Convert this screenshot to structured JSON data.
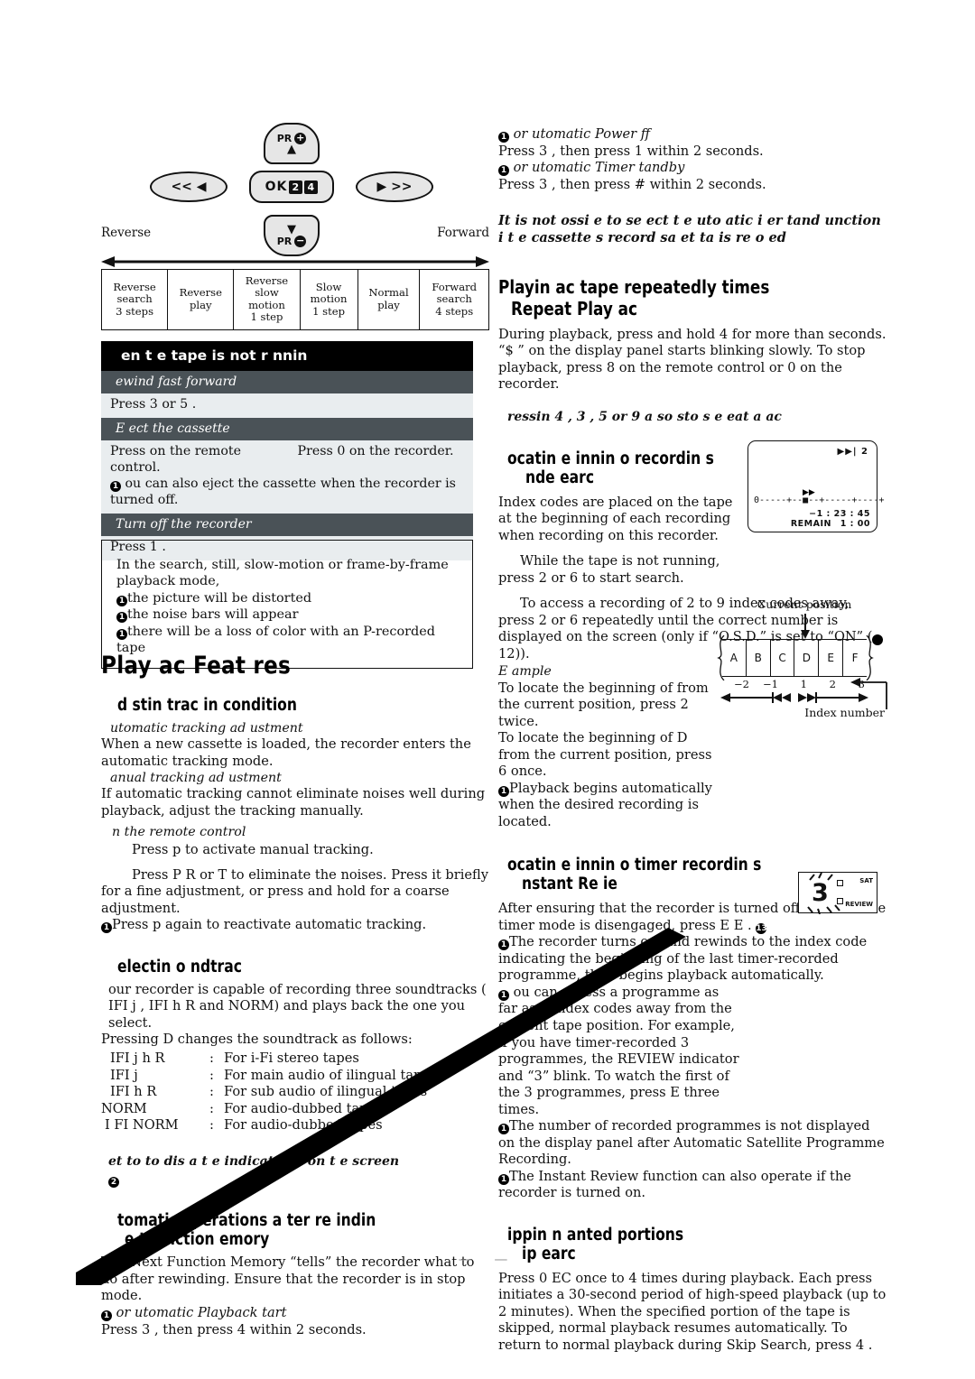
{
  "remote": {
    "key_up_label": "PR",
    "key_up_sign": "+",
    "key_up_arrow": "▲",
    "key_down_label": "PR",
    "key_down_sign": "−",
    "key_down_arrow": "▼",
    "key_ok_label": "OK",
    "key_ok_badge_a": "2",
    "key_ok_badge_b": "4",
    "key_left_label": "<< ◀",
    "key_right_label": "▶ >>",
    "label_reverse": "Reverse",
    "label_forward": "Forward"
  },
  "mode_table": {
    "cells": [
      "Reverse\nsearch\n3 steps",
      "Reverse\nplay",
      "Reverse\nslow\nmotion\n1 step",
      "Slow\nmotion\n1 step",
      "Normal\nplay",
      "Forward\nsearch\n4 steps"
    ]
  },
  "dark_table": {
    "title": "en t  e tape is not r  nnin",
    "rows": [
      {
        "kind": "sub",
        "left": "ewind fast forward",
        "right": ""
      },
      {
        "kind": "body",
        "left": "Press 3    or 5   .",
        "right": "",
        "single": true
      },
      {
        "kind": "sub",
        "left": "E ect the cassette",
        "right": ""
      },
      {
        "kind": "body",
        "left": "Press        on the remote control.",
        "right": "Press 0        on the recorder.",
        "single": false
      },
      {
        "kind": "note",
        "text": " ou can also eject the cassette when the recorder is turned off."
      },
      {
        "kind": "sub",
        "left": "Turn off the recorder",
        "right": ""
      },
      {
        "kind": "body",
        "left": "Press 1  .",
        "right": "",
        "single": true
      }
    ]
  },
  "note_box": {
    "intro": "In the search, still, slow-motion or frame-by-frame playback mode,",
    "items": [
      "the picture will be distorted",
      "the noise bars will appear",
      "there will be a loss of color with an   P-recorded tape"
    ]
  },
  "left_column": {
    "main_heading": "Play ac  Feat res",
    "sections": [
      {
        "id": "tracking",
        "heading": "d stin  trac in  condition",
        "blocks": [
          {
            "type": "subitalic",
            "text": " utomatic tracking ad ustment"
          },
          {
            "type": "para",
            "text": "When a new cassette is loaded, the recorder enters the automatic tracking mode."
          },
          {
            "type": "subitalic",
            "text": " anual tracking ad ustment"
          },
          {
            "type": "para",
            "text": "If automatic tracking cannot eliminate noises well during playback, adjust the tracking manually."
          },
          {
            "type": "subitalic-ind",
            "text": " n the remote control"
          },
          {
            "type": "para-ind",
            "text": "Press  p      to activate manual tracking."
          },
          {
            "type": "para-ind",
            "text": "Press  P  R  or T  to eliminate the noises. Press it briefly for a fine adjustment, or press and hold for a coarse adjustment."
          },
          {
            "type": "bullet",
            "text": "Press  p      again to reactivate automatic tracking."
          }
        ]
      },
      {
        "id": "soundtrack",
        "heading": "electin   o ndtrac",
        "blocks": [
          {
            "type": "para-ind",
            "text": " our recorder is capable of recording three soundtracks (   IFI    j ,  IFI h  R and NORM) and plays back the one you select."
          },
          {
            "type": "para",
            "text": "Pressing       D     changes the soundtrack as follows:"
          }
        ],
        "list": [
          {
            "left": "IFI    j h    R",
            "right": "For    i-Fi stereo tapes"
          },
          {
            "left": "IFI    j",
            "right": "For main audio of   ilingual tapes"
          },
          {
            "left": "IFI h  R",
            "right": "For sub audio of   ilingual tapes"
          },
          {
            "left": "NORM",
            "right": "For audio-dubbed tapes"
          },
          {
            "left": " I FI NORM",
            "right": "For audio-dubbed tapes"
          }
        ],
        "footnote": " et           to        to dis  a  t e indications on t e screen"
      },
      {
        "id": "next-function-memory",
        "heading_a": "tomatic operations a ter re  indin",
        "heading_b": "e t F nction   emory",
        "blocks": [
          {
            "type": "para",
            "text": "The Next Function Memory “tells” the recorder what to do after rewinding. Ensure that the recorder is in stop mode."
          },
          {
            "type": "bullet-italic",
            "text": " or   utomatic Playback  tart"
          },
          {
            "type": "para",
            "text": "Press 3     , then press 4   within 2 seconds."
          }
        ]
      }
    ]
  },
  "right_column": {
    "top_blocks": [
      {
        "type": "bullet-italic",
        "text": " or   utomatic Power    ff"
      },
      {
        "type": "para",
        "text": "Press 3     , then press 1    within 2 seconds."
      },
      {
        "type": "bullet-italic",
        "text": " or   utomatic Timer   tandby"
      },
      {
        "type": "para",
        "text": "Press 3     , then press #  within 2 seconds."
      }
    ],
    "caution": "It is not  ossi  e to se ect t e   uto  atic  i er  tand    unction i  t e cassette s record sa et  ta  is re  o ed",
    "sections": [
      {
        "id": "repeat-play",
        "heading_a": "Playin   ac  tape repeatedly        times",
        "heading_b": "Repeat Play ac",
        "blocks": [
          {
            "type": "para",
            "text": "During playback, press and hold 4   for more than    seconds. “$  ” on the display panel starts blinking slowly. To stop playback, press 8  on the remote control or 0        on the recorder."
          }
        ],
        "footnote": " ressin   4 , 3   , 5     or 9  a so sto s  e eat  a   ac"
      },
      {
        "id": "index-search",
        "heading_a": "ocatin    e  innin  o  recordin s",
        "heading_b": "nde   earc",
        "blocks": [
          {
            "type": "para",
            "text": "Index codes are placed on the tape at the beginning of each recording when recording on this recorder."
          },
          {
            "type": "para-ind",
            "text": "While the tape is not running, press 2  or 6      to start search."
          },
          {
            "type": "para-ind",
            "text": "To access a recording of 2 to 9 index codes away, press 2       or 6       repeatedly until the correct number is displayed on the screen (only if “O.S.D.” is set to “ON” ("
          },
          {
            "type": "para-tail",
            "text": "12))."
          },
          {
            "type": "subitalic",
            "text": "E  ample"
          },
          {
            "type": "para",
            "text": "To locate the beginning of    from the current position, press 2      twice."
          },
          {
            "type": "para",
            "text": "To locate the beginning of D from the current position, press 6      once."
          },
          {
            "type": "bullet",
            "text": "Playback begins automatically when the desired recording is located."
          }
        ]
      },
      {
        "id": "instant-review",
        "heading_a": "ocatin    e  innin  o  timer recordin s",
        "heading_b": "nstant Re  ie",
        "blocks": [
          {
            "type": "para",
            "text": "After ensuring that the recorder is turned off and that the timer mode is disengaged, press   E  E  ."
          },
          {
            "type": "bullet",
            "text": "The recorder turns on, and rewinds to the index code indicating the beginning of the last timer-recorded programme, then begins playback automatically."
          },
          {
            "type": "bullet",
            "text": " ou can access a programme as far as 9 index codes away from the current tape position. For example, if you have timer-recorded 3 programmes, the REVIEW indicator and “3” blink. To watch the first of the 3 programmes, press       E    three times."
          },
          {
            "type": "bullet",
            "text": "The number of recorded programmes is not displayed on the display panel after Automatic Satellite Programme Recording."
          },
          {
            "type": "bullet",
            "text": "The Instant Review function can also operate if the recorder is turned on."
          }
        ]
      },
      {
        "id": "skip-search",
        "heading_a": "ippin   n anted portions",
        "heading_b": "ip  earc",
        "blocks": [
          {
            "type": "para",
            "text": "Press   0   EC    once to 4 times during playback. Each press initiates a 30-second period of high-speed playback (up to 2 minutes). When the specified portion of the tape is skipped, normal playback resumes automatically. To return to normal playback during Skip Search, press 4  ."
          }
        ]
      }
    ]
  },
  "display_panel": {
    "topright_icon": "▶▶|",
    "topright_value": "2",
    "scale": "0-----+--■--+-----+----+",
    "ff_icon": "▶▶",
    "time": "−1 : 23 : 45",
    "remain_label": "REMAIN",
    "remain_value": "1 : 00"
  },
  "tape_figure": {
    "current_position_label": "Current position",
    "cells": [
      "A",
      "B",
      "C",
      "D",
      "E",
      "F"
    ],
    "numbers": [
      "−2",
      "−1",
      "1",
      "2",
      "3"
    ],
    "index_number_label": "Index number"
  },
  "review_panel": {
    "number": "3",
    "sat_label": "SAT",
    "review_label": "REVIEW"
  },
  "badges": {
    "b1": "1",
    "b2": "2",
    "b13": "13"
  },
  "footer": {
    "dashes": "— —"
  },
  "colors": {
    "dark_header": "#000000",
    "dark_subrow": "#4a5257",
    "light_row": "#e9edef",
    "key_fill": "#e6e6e6",
    "text": "#111111"
  }
}
